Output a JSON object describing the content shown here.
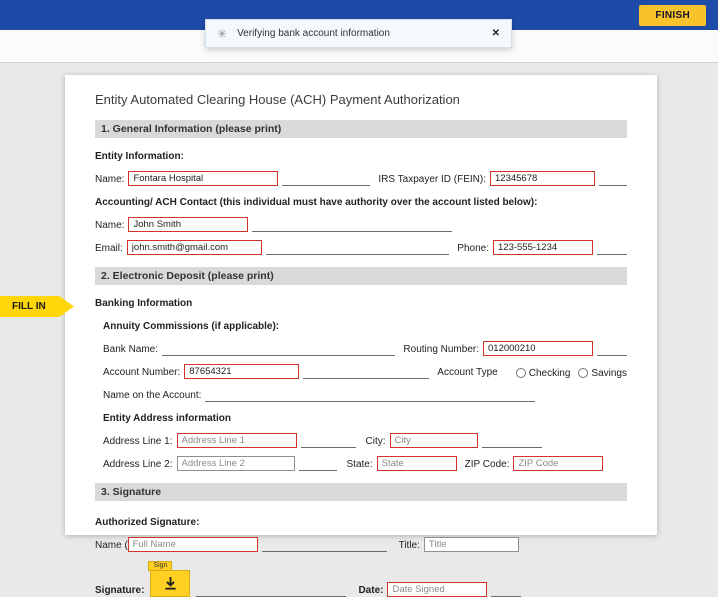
{
  "header": {
    "finish_label": "FINISH"
  },
  "toast": {
    "spinner_icon": "✳",
    "message": "Verifying bank account information",
    "close_label": "✕"
  },
  "fill_in_tab": {
    "label": "FILL IN"
  },
  "doc": {
    "title": "Entity Automated Clearing House (ACH) Payment Authorization",
    "s1": {
      "heading": "1. General Information (please print)",
      "entity_info": "Entity Information:",
      "name_label": "Name:",
      "name_value": "Fontara Hospital",
      "fein_label": "IRS Taxpayer ID (FEIN):",
      "fein_value": "12345678",
      "contact_heading": "Accounting/ ACH Contact (this individual must have authority over the account listed below):",
      "contact_name_label": "Name:",
      "contact_name_value": "John Smith",
      "email_label": "Email:",
      "email_value": "john.smith@gmail.com",
      "phone_label": "Phone:",
      "phone_value": "123-555-1234"
    },
    "s2": {
      "heading": "2. Electronic Deposit (please print)",
      "banking_heading": "Banking Information",
      "annuity_heading": "Annuity Commissions (if applicable):",
      "bank_name_label": "Bank Name:",
      "routing_label": "Routing Number:",
      "routing_value": "012000210",
      "account_number_label": "Account Number:",
      "account_number_value": "87654321",
      "account_type_label": "Account Type",
      "checking_label": "Checking",
      "savings_label": "Savings",
      "name_on_account_label": "Name on the Account:",
      "address_heading": "Entity Address information",
      "address1_label": "Address Line 1:",
      "address1_placeholder": "Address Line 1",
      "city_label": "City:",
      "city_placeholder": "City",
      "address2_label": "Address Line 2:",
      "address2_placeholder": "Address Line 2",
      "state_label": "State:",
      "state_placeholder": "State",
      "zip_label": "ZIP Code:",
      "zip_placeholder": "ZIP Code"
    },
    "s3": {
      "heading": "3. Signature",
      "authorized_heading": "Authorized Signature:",
      "name_label": "Name (please print):",
      "name_placeholder": "Full Name",
      "title_label": "Title:",
      "title_placeholder": "Title",
      "signature_label": "Signature:",
      "sign_tag": "Sign",
      "date_label": "Date:",
      "date_placeholder": "Date Signed"
    }
  }
}
